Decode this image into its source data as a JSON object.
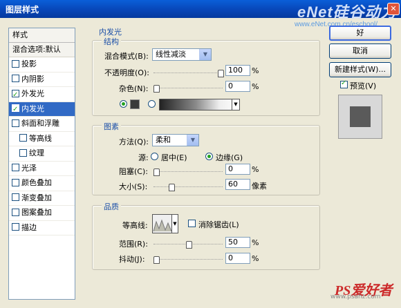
{
  "window": {
    "title": "图层样式",
    "watermark": "eNet硅谷动力",
    "watermark_url": "www.eNet.com.cn/eschool/"
  },
  "sidebar": {
    "header": "样式",
    "mix_options": "混合选项:默认",
    "items": [
      {
        "label": "投影",
        "checked": false,
        "active": false,
        "indent": false
      },
      {
        "label": "内阴影",
        "checked": false,
        "active": false,
        "indent": false
      },
      {
        "label": "外发光",
        "checked": true,
        "active": false,
        "indent": false
      },
      {
        "label": "内发光",
        "checked": true,
        "active": true,
        "indent": false
      },
      {
        "label": "斜面和浮雕",
        "checked": false,
        "active": false,
        "indent": false
      },
      {
        "label": "等高线",
        "checked": false,
        "active": false,
        "indent": true
      },
      {
        "label": "纹理",
        "checked": false,
        "active": false,
        "indent": true
      },
      {
        "label": "光泽",
        "checked": false,
        "active": false,
        "indent": false
      },
      {
        "label": "颜色叠加",
        "checked": false,
        "active": false,
        "indent": false
      },
      {
        "label": "渐变叠加",
        "checked": false,
        "active": false,
        "indent": false
      },
      {
        "label": "图案叠加",
        "checked": false,
        "active": false,
        "indent": false
      },
      {
        "label": "描边",
        "checked": false,
        "active": false,
        "indent": false
      }
    ]
  },
  "panel": {
    "title": "内发光",
    "structure": {
      "title": "结构",
      "blend_mode_label": "混合模式(B):",
      "blend_mode_value": "线性减淡",
      "opacity_label": "不透明度(O):",
      "opacity_value": "100",
      "opacity_fraction": 1.0,
      "noise_label": "杂色(N):",
      "noise_value": "0",
      "noise_fraction": 0.0,
      "percent": "%"
    },
    "elements": {
      "title": "图素",
      "method_label": "方法(Q):",
      "method_value": "柔和",
      "source_label": "源:",
      "source_center": "居中(E)",
      "source_edge": "边缘(G)",
      "choke_label": "阻塞(C):",
      "choke_value": "0",
      "choke_fraction": 0.0,
      "size_label": "大小(S):",
      "size_value": "60",
      "size_fraction": 0.24,
      "size_unit": "像素",
      "percent": "%"
    },
    "quality": {
      "title": "品质",
      "contour_label": "等高线:",
      "antialias_label": "消除锯齿(L)",
      "range_label": "范围(R):",
      "range_value": "50",
      "range_fraction": 0.5,
      "jitter_label": "抖动(J):",
      "jitter_value": "0",
      "jitter_fraction": 0.0,
      "percent": "%"
    }
  },
  "buttons": {
    "ok": "好",
    "cancel": "取消",
    "new_style": "新建样式(W)...",
    "preview": "预览(V)"
  },
  "footer_mark": {
    "brand": "PS爱好者",
    "url": "www.psahz.com"
  }
}
